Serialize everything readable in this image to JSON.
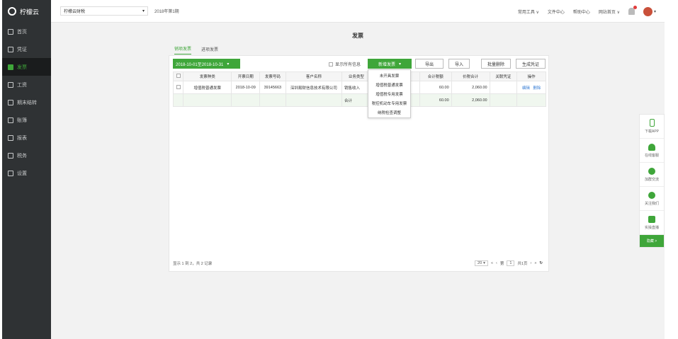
{
  "app": {
    "logo_text": "柠檬云"
  },
  "sidebar": {
    "items": [
      {
        "label": "首页",
        "icon": "home-icon"
      },
      {
        "label": "凭证",
        "icon": "voucher-icon"
      },
      {
        "label": "发票",
        "icon": "invoice-icon",
        "active": true
      },
      {
        "label": "工资",
        "icon": "salary-icon"
      },
      {
        "label": "期末结转",
        "icon": "period-close-icon"
      },
      {
        "label": "账簿",
        "icon": "ledger-icon"
      },
      {
        "label": "报表",
        "icon": "report-icon"
      },
      {
        "label": "税务",
        "icon": "tax-icon"
      },
      {
        "label": "设置",
        "icon": "settings-icon"
      }
    ]
  },
  "topbar": {
    "company": "柠檬云财税",
    "period": "2018年第1期",
    "links": [
      "常用工具 ∨",
      "文件中心",
      "帮助中心",
      "网站首页 ∨"
    ]
  },
  "page": {
    "title": "发票",
    "tabs": [
      "销项发票",
      "进项发票"
    ],
    "date_range": "2018-10-01至2018-10-31",
    "show_all_label": "显示所有信息",
    "new_invoice_label": "新增发票",
    "buttons": [
      "导出",
      "导入",
      "批量删除",
      "生成凭证"
    ],
    "dropdown": [
      "未开具发票",
      "增值税普通发票",
      "增值税专用发票",
      "税控机动车专用发票",
      "纳税检查调整"
    ]
  },
  "table": {
    "headers": [
      "发票种类",
      "开票日期",
      "发票号码",
      "客户名称",
      "业务类型",
      "",
      "合计税额",
      "价税合计",
      "关联凭证",
      "操作"
    ],
    "rows": [
      {
        "type": "增值税普通发票",
        "date": "2018-10-09",
        "number": "39145663",
        "customer": "深圳易财信息技术有限公司",
        "biz": "销售收入",
        "tax": "60.00",
        "total": "2,060.00",
        "voucher": "",
        "edit": "编辑",
        "del": "删除"
      }
    ],
    "subtotal": {
      "label": "合计",
      "tax": "60.00",
      "total": "2,060.00"
    }
  },
  "footer": {
    "summary": "显示 1 到 2，共 2 记录",
    "page_size": "20",
    "page_label_pre": "第",
    "page_num": "1",
    "page_label_post": "共1页"
  },
  "float_bar": {
    "items": [
      "下载APP",
      "在线客服",
      "加群交流",
      "关注我们",
      "实操直播"
    ],
    "hide_label": "隐藏 >"
  }
}
